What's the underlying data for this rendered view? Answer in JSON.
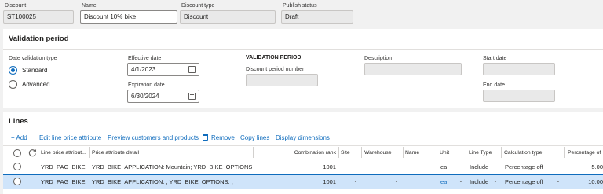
{
  "header": {
    "discount_label": "Discount",
    "discount_value": "ST100025",
    "name_label": "Name",
    "name_value": "Discount 10% bike",
    "type_label": "Discount type",
    "type_value": "Discount",
    "status_label": "Publish status",
    "status_value": "Draft"
  },
  "validation": {
    "title": "Validation period",
    "date_type_label": "Date validation type",
    "options": [
      "Standard",
      "Advanced"
    ],
    "selected": "Standard",
    "effective_label": "Effective date",
    "effective_value": "4/1/2023",
    "expiration_label": "Expiration date",
    "expiration_value": "6/30/2024",
    "period_heading": "VALIDATION PERIOD",
    "period_number_label": "Discount period number",
    "description_label": "Description",
    "start_label": "Start date",
    "end_label": "End date"
  },
  "lines": {
    "title": "Lines",
    "toolbar": [
      "+ Add",
      "Edit line price attribute",
      "Preview customers and products",
      "Remove",
      "Copy lines",
      "Display dimensions"
    ],
    "columns": [
      "Line price attribut...",
      "Price attribute detail",
      "Combination rank",
      "Site",
      "Warehouse",
      "Name",
      "Unit",
      "Line Type",
      "Calculation type",
      "Percentage of"
    ],
    "rows": [
      {
        "attr": "YRD_PAG_BIKE",
        "detail": "YRD_BIKE_APPLICATION: Mountain; YRD_BIKE_OPTIONS:...",
        "rank": "1001",
        "site": "",
        "warehouse": "",
        "name": "",
        "unit": "ea",
        "line_type": "Include",
        "calc_type": "Percentage off",
        "pct": "5.00",
        "selected": false
      },
      {
        "attr": "YRD_PAG_BIKE",
        "detail": "YRD_BIKE_APPLICATION: ; YRD_BIKE_OPTIONS: ;",
        "rank": "1001",
        "site": "",
        "warehouse": "",
        "name": "",
        "unit": "ea",
        "line_type": "Include",
        "calc_type": "Percentage off",
        "pct": "10.00",
        "selected": true
      }
    ]
  },
  "colors": {
    "accent": "#0f6cbd",
    "selected_row": "#cfe4fa"
  }
}
